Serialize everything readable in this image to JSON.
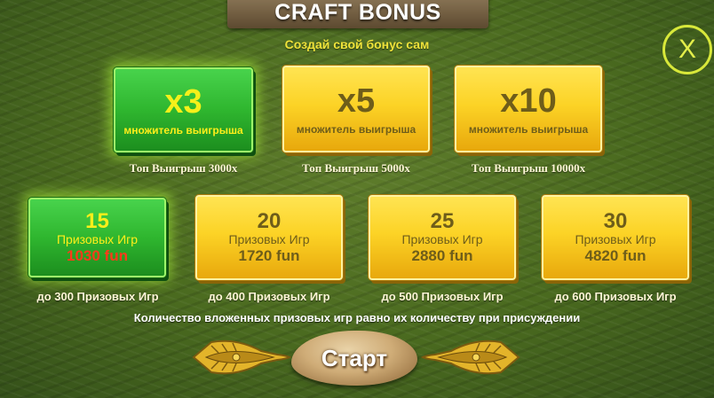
{
  "header": {
    "title": "CRAFT BONUS",
    "subtitle": "Создай свой бонус сам"
  },
  "close": {
    "label": "X"
  },
  "multipliers": [
    {
      "value": "x3",
      "label": "множитель выигрыша",
      "caption": "Топ Выигрыш 3000x",
      "selected": true
    },
    {
      "value": "x5",
      "label": "множитель выигрыша",
      "caption": "Топ Выигрыш 5000x",
      "selected": false
    },
    {
      "value": "x10",
      "label": "множитель выигрыша",
      "caption": "Топ Выигрыш 10000x",
      "selected": false
    }
  ],
  "free_games": [
    {
      "count": "15",
      "label": "Призовых Игр",
      "price": "1030 fun",
      "caption": "до 300 Призовых Игр",
      "selected": true
    },
    {
      "count": "20",
      "label": "Призовых Игр",
      "price": "1720 fun",
      "caption": "до 400 Призовых Игр",
      "selected": false
    },
    {
      "count": "25",
      "label": "Призовых Игр",
      "price": "2880 fun",
      "caption": "до 500 Призовых Игр",
      "selected": false
    },
    {
      "count": "30",
      "label": "Призовых Игр",
      "price": "4820 fun",
      "caption": "до 600 Призовых Игр",
      "selected": false
    }
  ],
  "note": "Количество вложенных призовых игр равно их количеству при присуждении",
  "start": {
    "label": "Старт"
  },
  "colors": {
    "gold": "#fcd326",
    "green": "#2fb62f",
    "accent": "#f0e33a",
    "price_selected": "#ff3a1a"
  }
}
